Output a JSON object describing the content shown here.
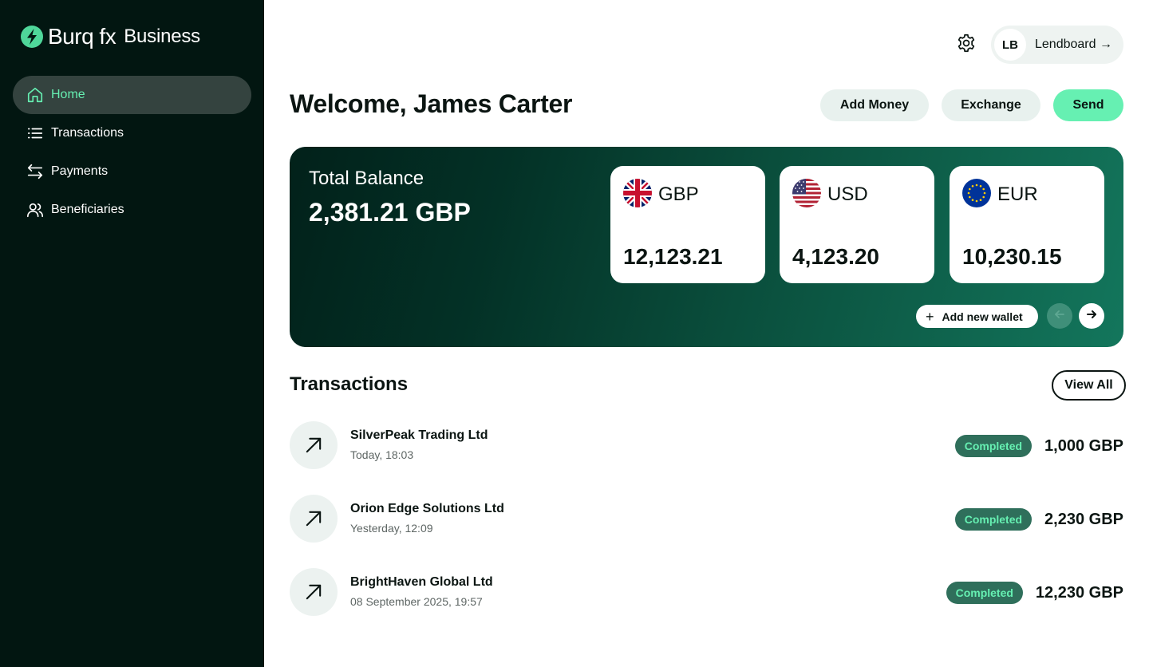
{
  "brand": {
    "name": "Burq fx",
    "sub": "Business",
    "logo_icon": "bolt-icon",
    "accent": "#66f0b2"
  },
  "sidebar": {
    "items": [
      {
        "label": "Home",
        "icon": "home-icon",
        "active": true
      },
      {
        "label": "Transactions",
        "icon": "list-icon",
        "active": false
      },
      {
        "label": "Payments",
        "icon": "arrows-swap-icon",
        "active": false
      },
      {
        "label": "Beneficiaries",
        "icon": "users-icon",
        "active": false
      }
    ]
  },
  "header": {
    "settings_icon": "gear-icon",
    "org": {
      "initials": "LB",
      "name": "Lendboard →"
    }
  },
  "main": {
    "welcome": "Welcome, James Carter",
    "actions": {
      "add_money": "Add Money",
      "exchange": "Exchange",
      "send": "Send"
    },
    "balance": {
      "label": "Total Balance",
      "value": "2,381.21 GBP",
      "wallets": [
        {
          "code": "GBP",
          "amount": "12,123.21",
          "flag": "uk-flag-icon"
        },
        {
          "code": "USD",
          "amount": "4,123.20",
          "flag": "us-flag-icon"
        },
        {
          "code": "EUR",
          "amount": "10,230.15",
          "flag": "eu-flag-icon"
        }
      ],
      "add_wallet_label": "Add new wallet"
    },
    "transactions": {
      "title": "Transactions",
      "view_all": "View All",
      "rows": [
        {
          "name": "SilverPeak Trading Ltd",
          "date": "Today, 18:03",
          "status": "Completed",
          "amount": "1,000 GBP"
        },
        {
          "name": "Orion Edge Solutions Ltd",
          "date": "Yesterday, 12:09",
          "status": "Completed",
          "amount": "2,230 GBP"
        },
        {
          "name": "BrightHaven Global Ltd",
          "date": "08 September 2025, 19:57",
          "status": "Completed",
          "amount": "12,230 GBP"
        }
      ]
    }
  }
}
